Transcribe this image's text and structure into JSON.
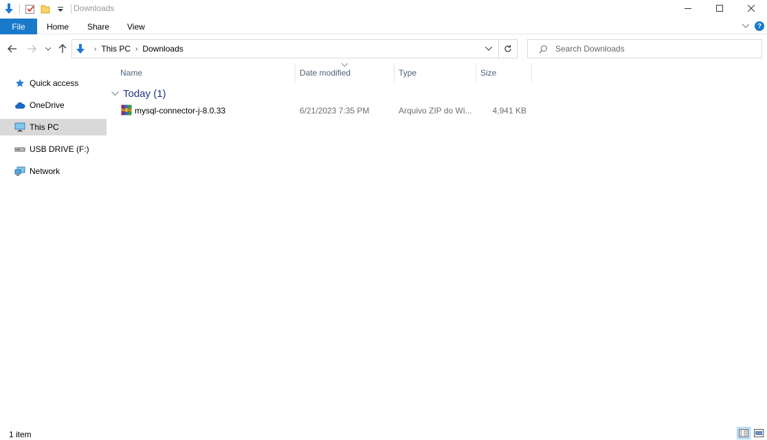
{
  "window": {
    "title": "Downloads",
    "controls": {
      "minimize": "—",
      "maximize": "☐",
      "close": "✕"
    }
  },
  "quick_access_toolbar": {
    "icons": [
      "download-arrow-icon",
      "properties-check-icon",
      "new-folder-icon",
      "customize-dropdown-icon"
    ]
  },
  "ribbon": {
    "tabs": [
      {
        "label": "File",
        "active": true
      },
      {
        "label": "Home"
      },
      {
        "label": "Share"
      },
      {
        "label": "View"
      }
    ],
    "help": "?"
  },
  "navigation": {
    "breadcrumb": [
      "This PC",
      "Downloads"
    ],
    "search_placeholder": "Search Downloads"
  },
  "sidebar": {
    "items": [
      {
        "label": "Quick access",
        "icon": "star-icon"
      },
      {
        "label": "OneDrive",
        "icon": "cloud-icon"
      },
      {
        "label": "This PC",
        "icon": "monitor-icon",
        "selected": true
      },
      {
        "label": "USB DRIVE (F:)",
        "icon": "usb-drive-icon"
      },
      {
        "label": "Network",
        "icon": "network-icon"
      }
    ]
  },
  "file_list": {
    "columns": [
      "Name",
      "Date modified",
      "Type",
      "Size"
    ],
    "group": {
      "label": "Today (1)"
    },
    "rows": [
      {
        "name": "mysql-connector-j-8.0.33",
        "date_modified": "6/21/2023 7:35 PM",
        "type": "Arquivo ZIP do Wi...",
        "size": "4,941 KB",
        "icon": "winrar-archive-icon"
      }
    ]
  },
  "status_bar": {
    "item_count": "1 item"
  },
  "colors": {
    "accent": "#1979ca",
    "group_header": "#1e3287",
    "column_header": "#4c607a",
    "selected_bg": "#d9d9d9"
  }
}
